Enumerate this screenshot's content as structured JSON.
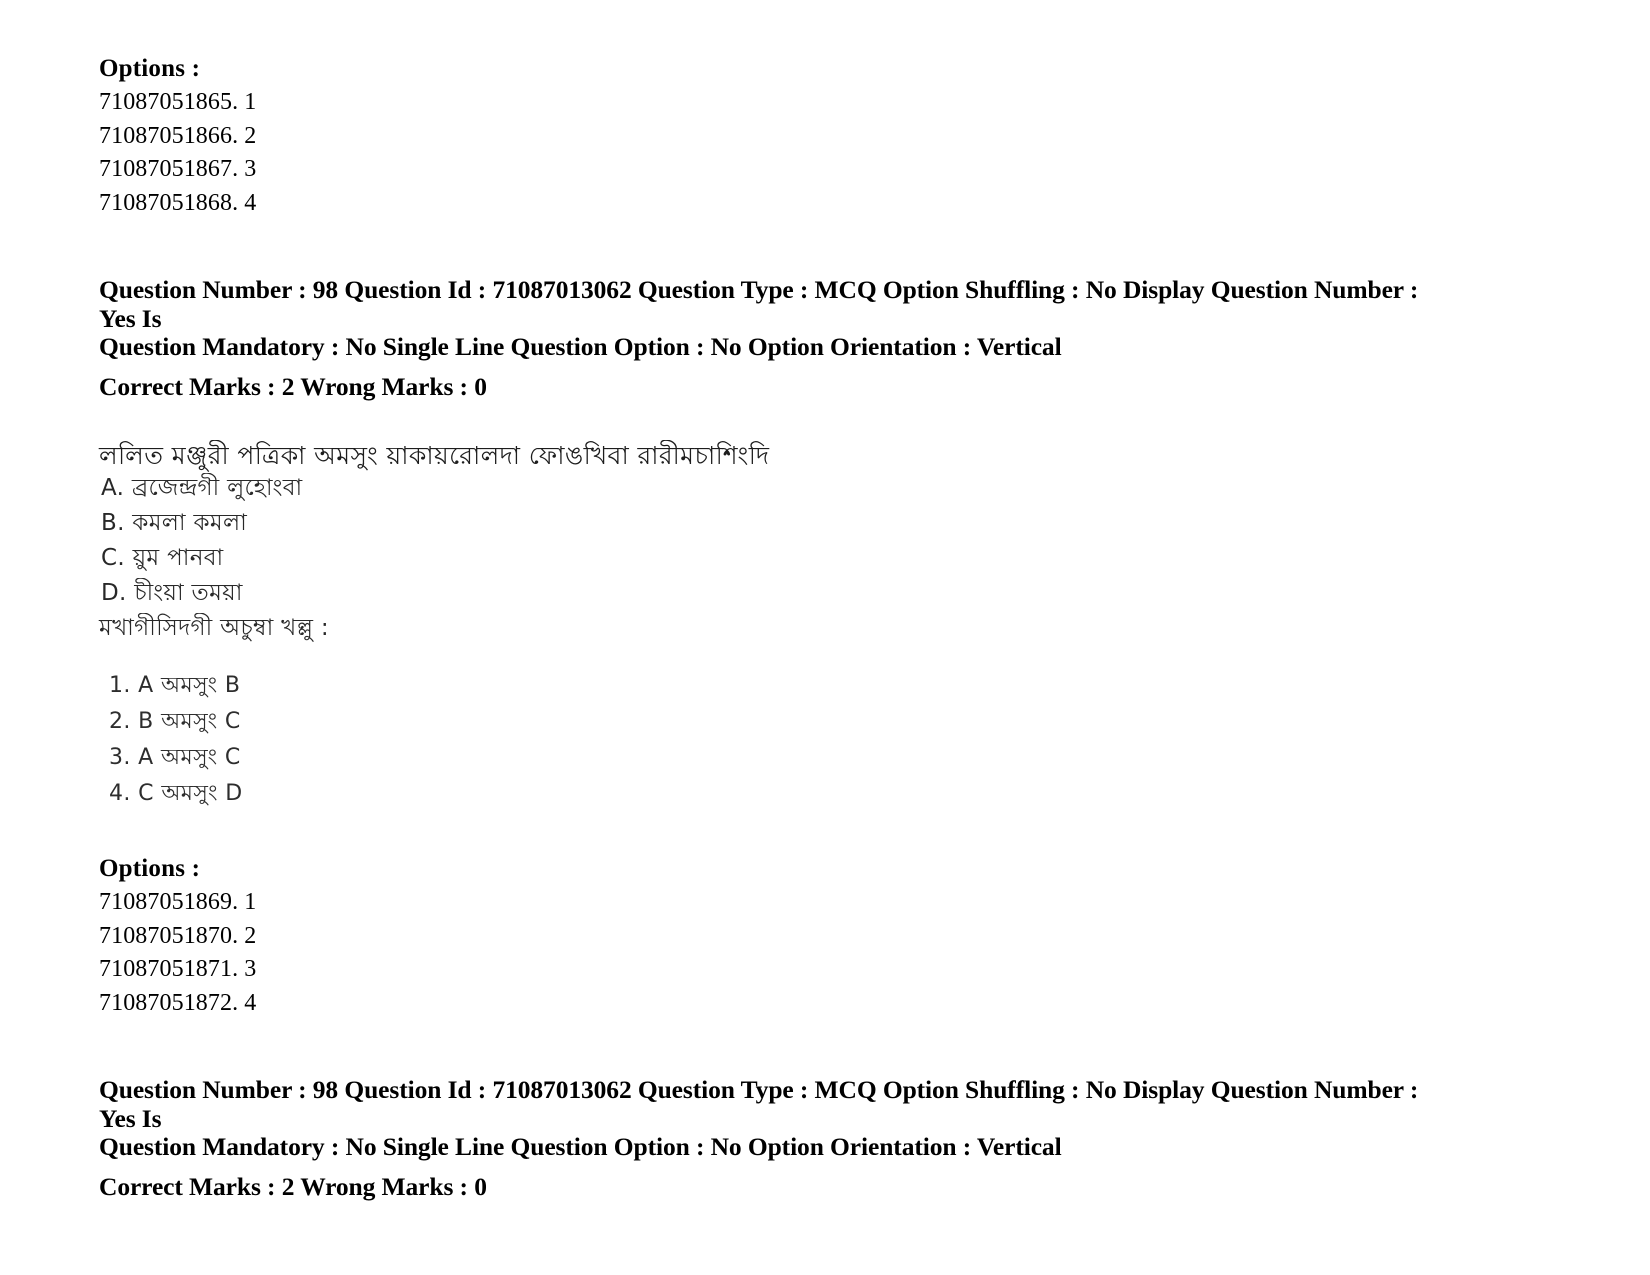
{
  "block1": {
    "options_heading": "Options :",
    "option_ids": [
      "71087051865. 1",
      "71087051866. 2",
      "71087051867. 3",
      "71087051868. 4"
    ]
  },
  "question_meta_1": {
    "line1": "Question Number : 98 Question Id : 71087013062 Question Type : MCQ Option Shuffling : No Display Question Number : Yes Is",
    "line2": "Question Mandatory : No Single Line Question Option : No Option Orientation : Vertical",
    "line3": "Correct Marks : 2 Wrong Marks : 0"
  },
  "question_body": {
    "stem": "ললিত মঞ্জুরী পত্রিকা অমসুং য়াকায়রোলদা ফোঙখিবা রারীমচাশিংদি",
    "choices": [
      "A. ব্রজেন্দ্রগী লুহোংবা",
      "B. কমলা কমলা",
      "C. য়ুম পানবা",
      "D. চীংয়া তময়া"
    ],
    "instruction": "মখাগীসিদগী অচুম্বা খল্লু :",
    "answers": [
      "1. A অমসুং B",
      "2. B অমসুং C",
      "3. A অমসুং C",
      "4. C অমসুং D"
    ]
  },
  "block2": {
    "options_heading": "Options :",
    "option_ids": [
      "71087051869. 1",
      "71087051870. 2",
      "71087051871. 3",
      "71087051872. 4"
    ]
  },
  "question_meta_2": {
    "line1": "Question Number : 98 Question Id : 71087013062 Question Type : MCQ Option Shuffling : No Display Question Number : Yes Is",
    "line2": "Question Mandatory : No Single Line Question Option : No Option Orientation : Vertical",
    "line3": "Correct Marks : 2 Wrong Marks : 0"
  },
  "colors": {
    "page_background": "#ffffff",
    "text": "#000000",
    "scan_text": "#1b1b1b"
  }
}
